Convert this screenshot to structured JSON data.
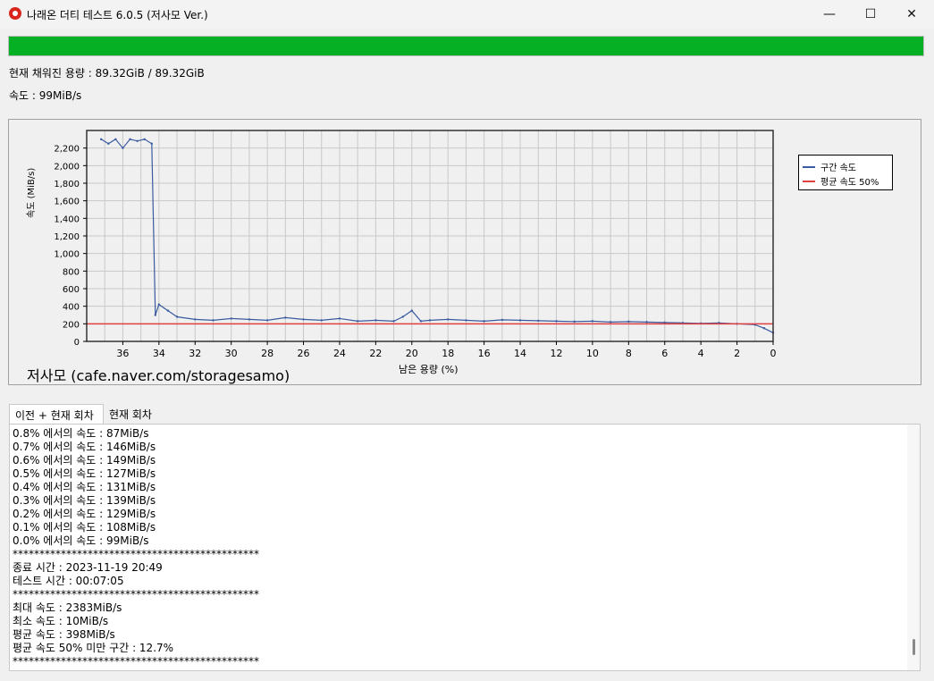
{
  "window": {
    "title": "나래온 더티 테스트 6.0.5 (저사모 Ver.)",
    "minimize_glyph": "—",
    "maximize_glyph": "☐",
    "close_glyph": "✕",
    "icons": [
      "app-icon",
      "minimize-icon",
      "maximize-icon",
      "close-icon"
    ]
  },
  "progress": {
    "fraction": 1.0,
    "color": "#06b025"
  },
  "status": {
    "written": "현재 채워진 용량 : 89.32GiB / 89.32GiB",
    "speed": "속도 : 99MiB/s"
  },
  "chart_data": {
    "type": "line",
    "xlabel": "남은 용량 (%)",
    "ylabel": "속도 (MiB/s)",
    "xlim": [
      38,
      0
    ],
    "ylim": [
      0,
      2400
    ],
    "x_ticks": [
      36,
      34,
      32,
      30,
      28,
      26,
      24,
      22,
      20,
      18,
      16,
      14,
      12,
      10,
      8,
      6,
      4,
      2,
      0
    ],
    "y_ticks": [
      0,
      200,
      400,
      600,
      800,
      1000,
      1200,
      1400,
      1600,
      1800,
      2000,
      2200
    ],
    "y_tick_labels": [
      "0",
      "200",
      "400",
      "600",
      "800",
      "1,000",
      "1,200",
      "1,400",
      "1,600",
      "1,800",
      "2,000",
      "2,200"
    ],
    "grid": true,
    "legend_position": "right",
    "series": [
      {
        "name": "구간 속도",
        "color": "#3a5ba0",
        "x": [
          37.2,
          36.8,
          36.4,
          36.0,
          35.6,
          35.2,
          34.8,
          34.4,
          34.2,
          34.0,
          33.5,
          33.0,
          32.0,
          31.0,
          30.0,
          29.0,
          28.0,
          27.0,
          26.0,
          25.0,
          24.0,
          23.0,
          22.0,
          21.0,
          20.5,
          20.0,
          19.5,
          19.0,
          18.0,
          17.0,
          16.0,
          15.0,
          14.0,
          13.0,
          12.0,
          11.0,
          10.0,
          9.0,
          8.0,
          7.0,
          6.0,
          5.0,
          4.0,
          3.0,
          2.0,
          1.0,
          0.5,
          0.0
        ],
        "y": [
          2300,
          2250,
          2300,
          2200,
          2300,
          2280,
          2300,
          2250,
          300,
          420,
          350,
          280,
          250,
          240,
          260,
          250,
          240,
          270,
          250,
          240,
          260,
          230,
          240,
          230,
          280,
          350,
          230,
          240,
          250,
          240,
          230,
          245,
          240,
          235,
          230,
          225,
          230,
          220,
          225,
          220,
          215,
          210,
          205,
          210,
          200,
          190,
          150,
          99
        ]
      },
      {
        "name": "평균 속도 50%",
        "color": "#e04040",
        "x": [
          38,
          0
        ],
        "y": [
          199,
          199
        ]
      }
    ]
  },
  "chart_caption": "저사모 (cafe.naver.com/storagesamo)",
  "tabs": [
    {
      "label": "이전 + 현재 회차",
      "active": true
    },
    {
      "label": "현재 회차",
      "active": false
    }
  ],
  "log": [
    "0.8% 에서의 속도 : 87MiB/s",
    "0.7% 에서의 속도 : 146MiB/s",
    "0.6% 에서의 속도 : 149MiB/s",
    "0.5% 에서의 속도 : 127MiB/s",
    "0.4% 에서의 속도 : 131MiB/s",
    "0.3% 에서의 속도 : 139MiB/s",
    "0.2% 에서의 속도 : 129MiB/s",
    "0.1% 에서의 속도 : 108MiB/s",
    "0.0% 에서의 속도 : 99MiB/s",
    "**********************************************",
    "종료 시간 : 2023-11-19 20:49",
    "테스트 시간 : 00:07:05",
    "**********************************************",
    "최대 속도 : 2383MiB/s",
    "최소 속도 : 10MiB/s",
    "평균 속도 : 398MiB/s",
    "평균 속도 50% 미만 구간 : 12.7%",
    "**********************************************"
  ]
}
